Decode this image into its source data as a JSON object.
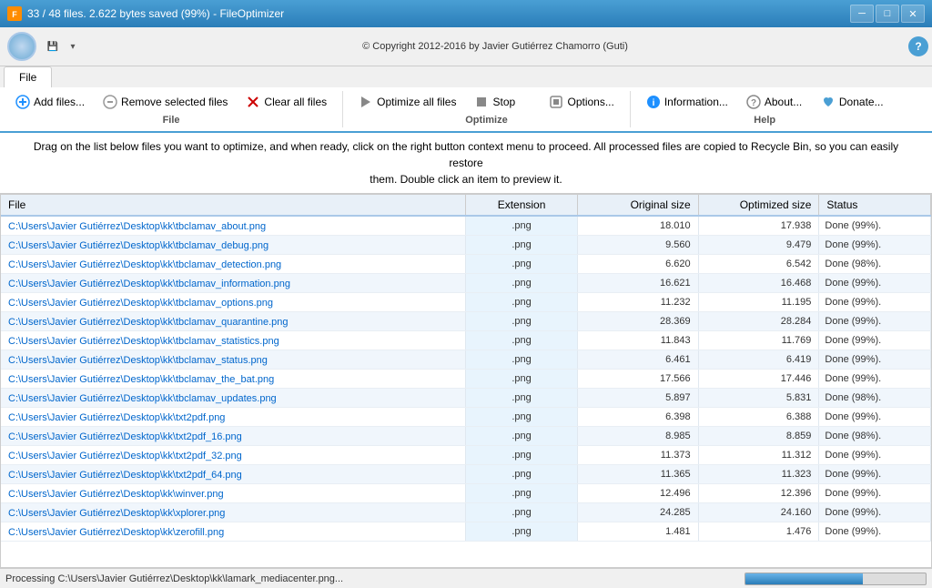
{
  "window": {
    "title": "33 / 48 files. 2.622 bytes saved (99%) - FileOptimizer",
    "copyright": "© Copyright 2012-2016 by Javier Gutiérrez Chamorro (Guti)"
  },
  "titlebar": {
    "minimize": "─",
    "maximize": "□",
    "close": "✕"
  },
  "tab": {
    "label": "File"
  },
  "ribbon": {
    "groups": [
      {
        "label": "File",
        "buttons": [
          {
            "id": "add-files",
            "label": "Add files...",
            "icon": "+"
          },
          {
            "id": "remove-selected",
            "label": "Remove selected files",
            "icon": "○"
          },
          {
            "id": "clear-all",
            "label": "Clear all files",
            "icon": "✕"
          }
        ]
      },
      {
        "label": "Optimize",
        "buttons": [
          {
            "id": "optimize-all",
            "label": "Optimize all files",
            "icon": "▶"
          },
          {
            "id": "stop",
            "label": "Stop",
            "icon": "■"
          },
          {
            "id": "options",
            "label": "Options...",
            "icon": "⚙"
          }
        ]
      },
      {
        "label": "Help",
        "buttons": [
          {
            "id": "information",
            "label": "Information...",
            "icon": "ℹ"
          },
          {
            "id": "about",
            "label": "About...",
            "icon": "❓"
          },
          {
            "id": "donate",
            "label": "Donate...",
            "icon": "♥"
          }
        ]
      }
    ]
  },
  "instruction": {
    "line1": "Drag on the list below files you want to optimize, and when ready, click on the right button context menu to proceed. All processed files are copied to Recycle Bin, so you can easily restore",
    "line2": "them. Double click an item to preview it."
  },
  "table": {
    "headers": [
      "File",
      "Extension",
      "Original size",
      "Optimized size",
      "Status"
    ],
    "rows": [
      {
        "file": "C:\\Users\\Javier Gutiérrez\\Desktop\\kk\\tbclamav_about.png",
        "ext": ".png",
        "orig": "18.010",
        "opt": "17.938",
        "status": "Done (99%)."
      },
      {
        "file": "C:\\Users\\Javier Gutiérrez\\Desktop\\kk\\tbclamav_debug.png",
        "ext": ".png",
        "orig": "9.560",
        "opt": "9.479",
        "status": "Done (99%)."
      },
      {
        "file": "C:\\Users\\Javier Gutiérrez\\Desktop\\kk\\tbclamav_detection.png",
        "ext": ".png",
        "orig": "6.620",
        "opt": "6.542",
        "status": "Done (98%)."
      },
      {
        "file": "C:\\Users\\Javier Gutiérrez\\Desktop\\kk\\tbclamav_information.png",
        "ext": ".png",
        "orig": "16.621",
        "opt": "16.468",
        "status": "Done (99%)."
      },
      {
        "file": "C:\\Users\\Javier Gutiérrez\\Desktop\\kk\\tbclamav_options.png",
        "ext": ".png",
        "orig": "11.232",
        "opt": "11.195",
        "status": "Done (99%)."
      },
      {
        "file": "C:\\Users\\Javier Gutiérrez\\Desktop\\kk\\tbclamav_quarantine.png",
        "ext": ".png",
        "orig": "28.369",
        "opt": "28.284",
        "status": "Done (99%)."
      },
      {
        "file": "C:\\Users\\Javier Gutiérrez\\Desktop\\kk\\tbclamav_statistics.png",
        "ext": ".png",
        "orig": "11.843",
        "opt": "11.769",
        "status": "Done (99%)."
      },
      {
        "file": "C:\\Users\\Javier Gutiérrez\\Desktop\\kk\\tbclamav_status.png",
        "ext": ".png",
        "orig": "6.461",
        "opt": "6.419",
        "status": "Done (99%)."
      },
      {
        "file": "C:\\Users\\Javier Gutiérrez\\Desktop\\kk\\tbclamav_the_bat.png",
        "ext": ".png",
        "orig": "17.566",
        "opt": "17.446",
        "status": "Done (99%)."
      },
      {
        "file": "C:\\Users\\Javier Gutiérrez\\Desktop\\kk\\tbclamav_updates.png",
        "ext": ".png",
        "orig": "5.897",
        "opt": "5.831",
        "status": "Done (98%)."
      },
      {
        "file": "C:\\Users\\Javier Gutiérrez\\Desktop\\kk\\txt2pdf.png",
        "ext": ".png",
        "orig": "6.398",
        "opt": "6.388",
        "status": "Done (99%)."
      },
      {
        "file": "C:\\Users\\Javier Gutiérrez\\Desktop\\kk\\txt2pdf_16.png",
        "ext": ".png",
        "orig": "8.985",
        "opt": "8.859",
        "status": "Done (98%)."
      },
      {
        "file": "C:\\Users\\Javier Gutiérrez\\Desktop\\kk\\txt2pdf_32.png",
        "ext": ".png",
        "orig": "11.373",
        "opt": "11.312",
        "status": "Done (99%)."
      },
      {
        "file": "C:\\Users\\Javier Gutiérrez\\Desktop\\kk\\txt2pdf_64.png",
        "ext": ".png",
        "orig": "11.365",
        "opt": "11.323",
        "status": "Done (99%)."
      },
      {
        "file": "C:\\Users\\Javier Gutiérrez\\Desktop\\kk\\winver.png",
        "ext": ".png",
        "orig": "12.496",
        "opt": "12.396",
        "status": "Done (99%)."
      },
      {
        "file": "C:\\Users\\Javier Gutiérrez\\Desktop\\kk\\xplorer.png",
        "ext": ".png",
        "orig": "24.285",
        "opt": "24.160",
        "status": "Done (99%)."
      },
      {
        "file": "C:\\Users\\Javier Gutiérrez\\Desktop\\kk\\zerofill.png",
        "ext": ".png",
        "orig": "1.481",
        "opt": "1.476",
        "status": "Done (99%)."
      }
    ]
  },
  "statusbar": {
    "text": "Processing C:\\Users\\Javier Gutiérrez\\Desktop\\kk\\lamark_mediacenter.png...",
    "progress": 65
  },
  "colors": {
    "accent": "#4a9fd4",
    "link": "#0066cc",
    "row_even": "#f0f6fc",
    "row_odd": "#ffffff",
    "ext_bg": "#e8f4fd"
  }
}
